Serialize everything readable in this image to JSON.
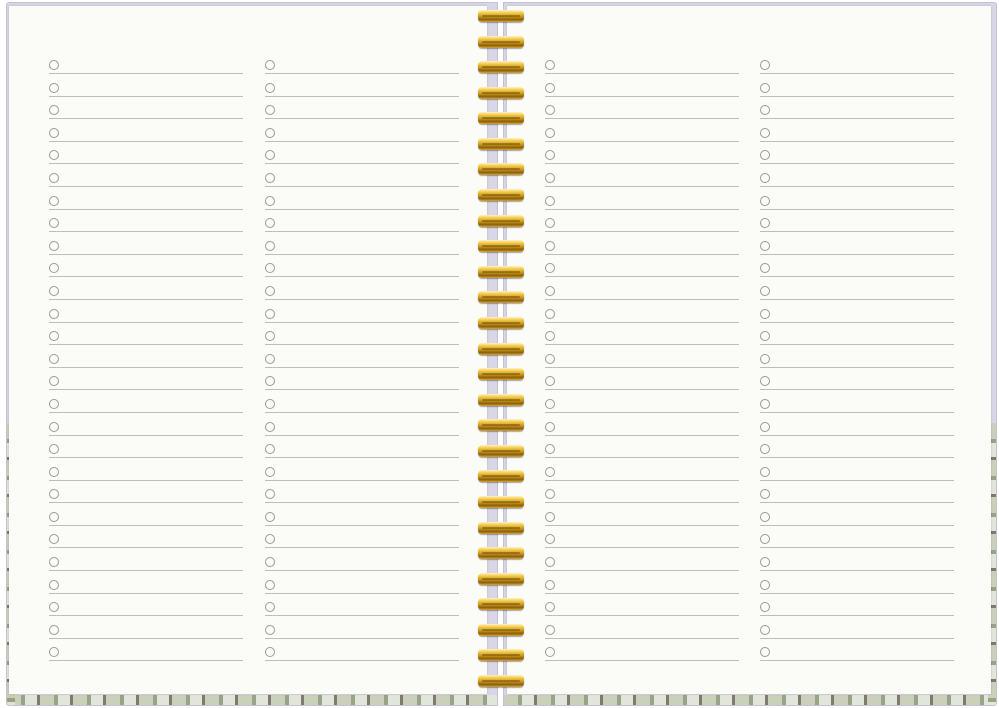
{
  "planner": {
    "left_page": {
      "columns": 2,
      "rows_per_column": 27
    },
    "right_page": {
      "columns": 2,
      "rows_per_column": 27
    },
    "binding": {
      "type": "spiral",
      "rings": 27,
      "color": "#d4a52e"
    },
    "cover_color": "#d9d6e6",
    "page_color": "#fbfbf8"
  }
}
